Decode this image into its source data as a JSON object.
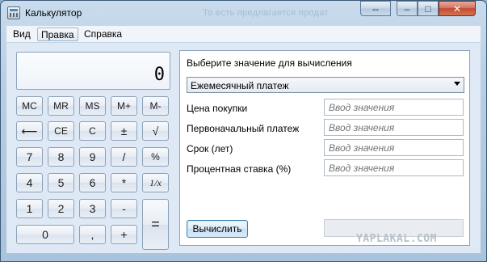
{
  "window": {
    "title": "Калькулятор",
    "background_text": "То есть предлагается продат",
    "restore_glyph": "⇔",
    "minimize_glyph": "–",
    "maximize_glyph": "□",
    "close_glyph": "✕"
  },
  "menu": [
    "Вид",
    "Правка",
    "Справка"
  ],
  "display": {
    "value": "0"
  },
  "keypad": {
    "memory": [
      "MC",
      "MR",
      "MS",
      "M+",
      "M-"
    ],
    "row2": [
      "⟵",
      "CE",
      "C",
      "±",
      "√"
    ],
    "row3": [
      "7",
      "8",
      "9",
      "/",
      "%"
    ],
    "row4": [
      "4",
      "5",
      "6",
      "*",
      "1/x"
    ],
    "row5": [
      "1",
      "2",
      "3",
      "-"
    ],
    "row6": [
      "0",
      ",",
      "+"
    ],
    "equals": "="
  },
  "panel": {
    "title": "Выберите значение для вычисления",
    "dropdown_value": "Ежемесячный платеж",
    "fields": [
      {
        "label": "Цена покупки",
        "placeholder": "Ввод значения"
      },
      {
        "label": "Первоначальный платеж",
        "placeholder": "Ввод значения"
      },
      {
        "label": "Срок (лет)",
        "placeholder": "Ввод значения"
      },
      {
        "label": "Процентная ставка (%)",
        "placeholder": "Ввод значения"
      }
    ],
    "compute_label": "Вычислить",
    "result_value": ""
  },
  "watermark": "YAPLAKAL.COM",
  "colors": {
    "accent": "#3c7fb1",
    "close": "#c24b32"
  }
}
